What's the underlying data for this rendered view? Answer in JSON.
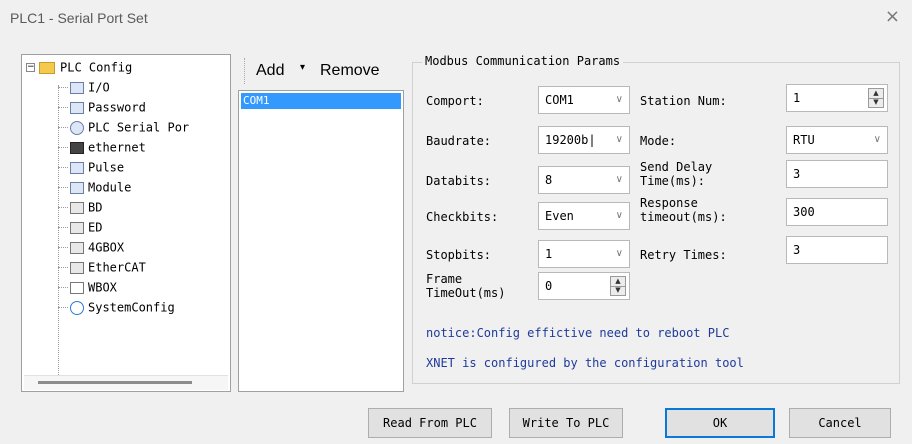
{
  "window": {
    "title": "PLC1 - Serial Port  Set",
    "close_glyph": "×"
  },
  "tree": {
    "root_label": "PLC Config",
    "expander": "⊟",
    "items": [
      {
        "label": "I/O",
        "icon": "io-icon"
      },
      {
        "label": "Password",
        "icon": "password-icon"
      },
      {
        "label": "PLC Serial Por",
        "icon": "serial-port-icon"
      },
      {
        "label": "ethernet",
        "icon": "ethernet-icon"
      },
      {
        "label": "Pulse",
        "icon": "pulse-icon"
      },
      {
        "label": "Module",
        "icon": "module-icon"
      },
      {
        "label": "BD",
        "icon": "bd-icon"
      },
      {
        "label": "ED",
        "icon": "ed-icon"
      },
      {
        "label": "4GBOX",
        "icon": "4gbox-icon"
      },
      {
        "label": "EtherCAT",
        "icon": "ethercat-icon"
      },
      {
        "label": "WBOX",
        "icon": "wbox-icon"
      },
      {
        "label": "SystemConfig",
        "icon": "gear-icon"
      }
    ]
  },
  "port_list": {
    "add_label": "Add",
    "caret": "▾",
    "remove_label": "Remove",
    "items": [
      "COM1"
    ]
  },
  "params": {
    "group_title": "Modbus Communication Params",
    "comport": {
      "label": "Comport:",
      "value": "COM1"
    },
    "baudrate": {
      "label": "Baudrate:",
      "value": "19200b|"
    },
    "databits": {
      "label": "Databits:",
      "value": "8"
    },
    "checkbits": {
      "label": "Checkbits:",
      "value": "Even"
    },
    "stopbits": {
      "label": "Stopbits:",
      "value": "1"
    },
    "frame_timeout": {
      "label_line1": "Frame",
      "label_line2": "TimeOut(ms)",
      "value": "0"
    },
    "station_num": {
      "label": "Station Num:",
      "value": "1"
    },
    "mode": {
      "label": "Mode:",
      "value": "RTU"
    },
    "send_delay": {
      "label_line1": "Send Delay",
      "label_line2": "Time(ms):",
      "value": "3"
    },
    "response_timeout": {
      "label_line1": "Response",
      "label_line2": "timeout(ms):",
      "value": "300"
    },
    "retry_times": {
      "label": "Retry Times:",
      "value": "3"
    },
    "chevron": "∨",
    "spin_up": "▲",
    "spin_down": "▼"
  },
  "notices": {
    "line1": "notice:Config effictive need to reboot PLC",
    "line2": "XNET is configured by the configuration tool",
    "color": "#1f3b9a"
  },
  "buttons": {
    "read": "Read From PLC",
    "write": "Write To PLC",
    "ok": "OK",
    "cancel": "Cancel"
  }
}
